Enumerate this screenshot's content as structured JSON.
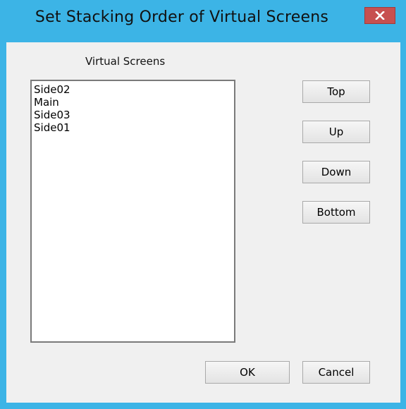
{
  "window": {
    "title": "Set Stacking Order of Virtual Screens",
    "accent_color": "#3cb4e6",
    "close_color": "#c75050",
    "close_icon": "close-icon"
  },
  "list": {
    "label": "Virtual Screens",
    "items": [
      "Side02",
      "Main",
      "Side03",
      "Side01"
    ]
  },
  "buttons": {
    "top": "Top",
    "up": "Up",
    "down": "Down",
    "bottom": "Bottom",
    "ok": "OK",
    "cancel": "Cancel"
  }
}
